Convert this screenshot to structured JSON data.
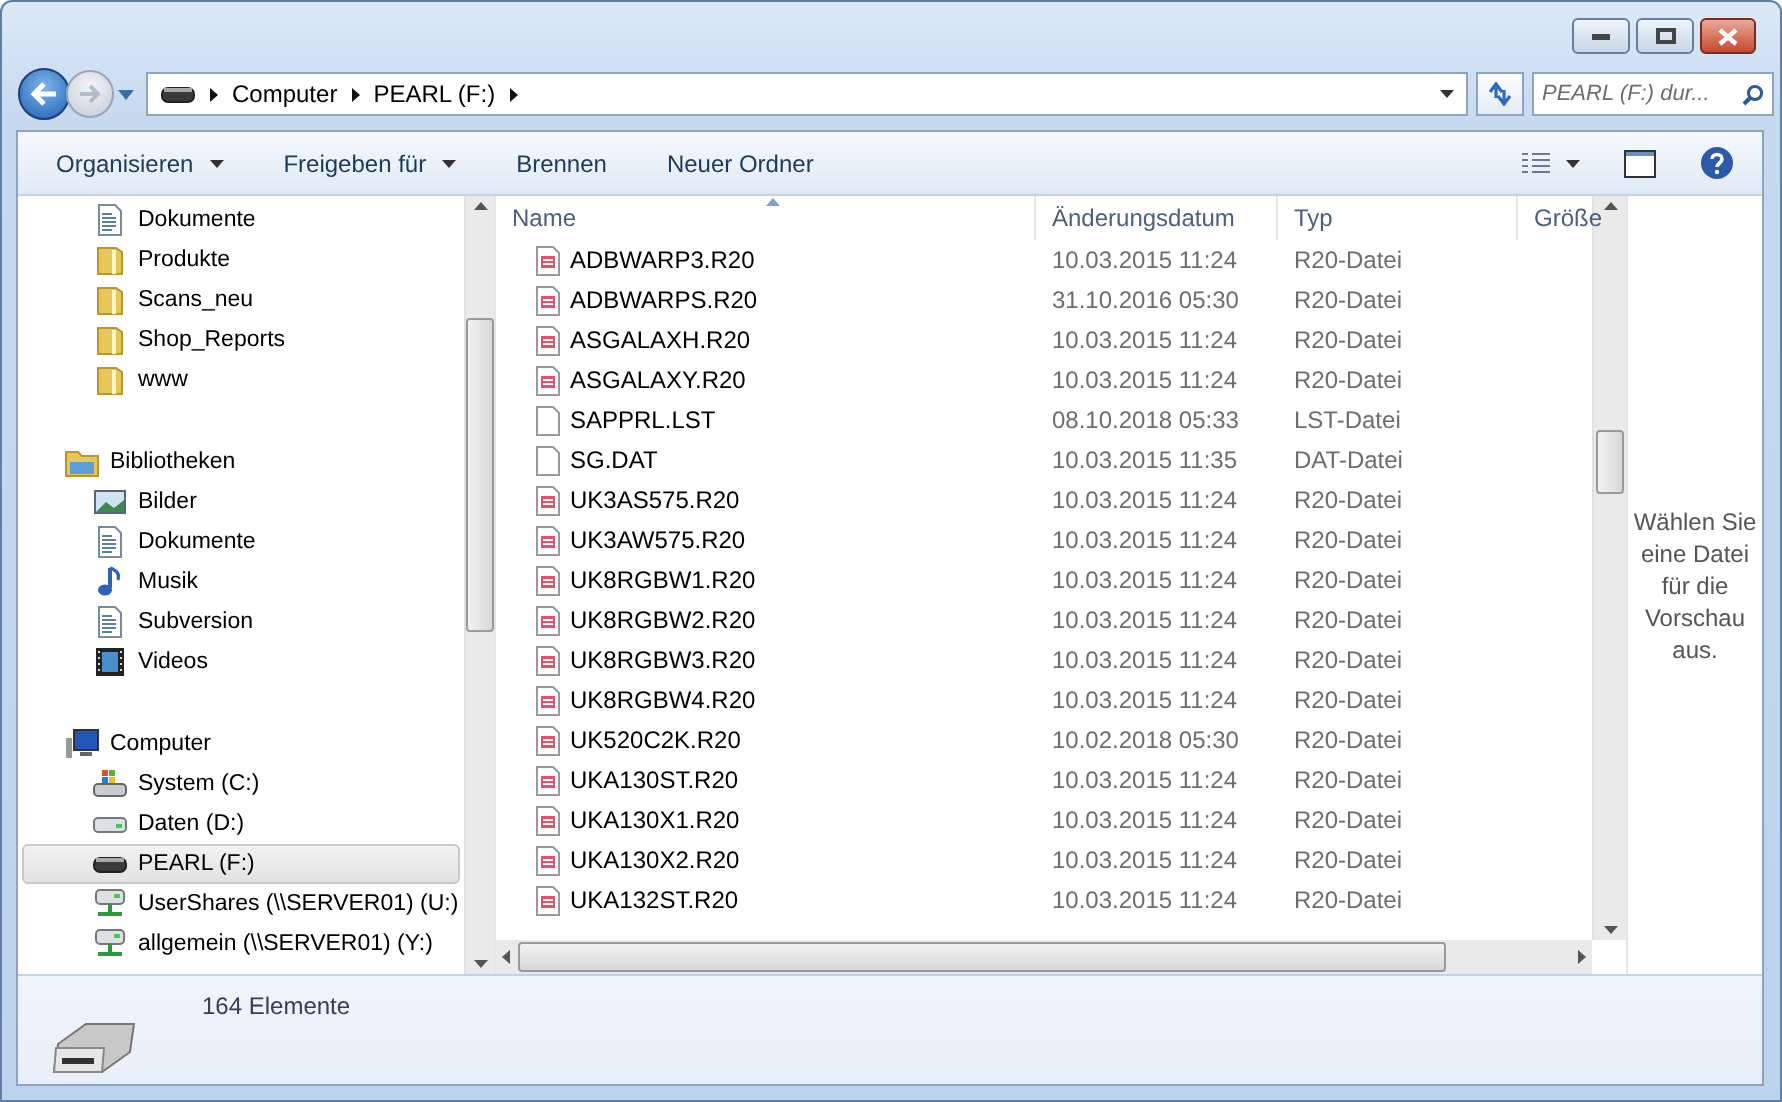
{
  "address_bar": {
    "breadcrumbs": [
      "Computer",
      "PEARL (F:)"
    ]
  },
  "search": {
    "placeholder": "PEARL (F:) dur..."
  },
  "toolbar": {
    "buttons": [
      {
        "label": "Organisieren",
        "dropdown": true
      },
      {
        "label": "Freigeben für",
        "dropdown": true
      },
      {
        "label": "Brennen",
        "dropdown": false
      },
      {
        "label": "Neuer Ordner",
        "dropdown": false
      }
    ]
  },
  "sidebar": {
    "groups": [
      {
        "items": [
          {
            "label": "Dokumente",
            "kind": "document",
            "selected": false
          },
          {
            "label": "Produkte",
            "kind": "folder",
            "selected": false
          },
          {
            "label": "Scans_neu",
            "kind": "folder",
            "selected": false
          },
          {
            "label": "Shop_Reports",
            "kind": "folder",
            "selected": false
          },
          {
            "label": "www",
            "kind": "folder",
            "selected": false
          }
        ]
      },
      {
        "label": "Bibliotheken",
        "kind": "libraries",
        "selected": false,
        "items": [
          {
            "label": "Bilder",
            "kind": "pictures",
            "selected": false
          },
          {
            "label": "Dokumente",
            "kind": "document",
            "selected": false
          },
          {
            "label": "Musik",
            "kind": "music",
            "selected": false
          },
          {
            "label": "Subversion",
            "kind": "document",
            "selected": false
          },
          {
            "label": "Videos",
            "kind": "video",
            "selected": false
          }
        ]
      },
      {
        "label": "Computer",
        "kind": "computer",
        "selected": false,
        "items": [
          {
            "label": "System (C:)",
            "kind": "system-drive",
            "selected": false
          },
          {
            "label": "Daten (D:)",
            "kind": "drive",
            "selected": false
          },
          {
            "label": "PEARL (F:)",
            "kind": "removable",
            "selected": true
          },
          {
            "label": "UserShares (\\\\SERVER01) (U:)",
            "kind": "network",
            "selected": false
          },
          {
            "label": "allgemein (\\\\SERVER01) (Y:)",
            "kind": "network",
            "selected": false
          }
        ]
      }
    ]
  },
  "file_list": {
    "columns": [
      {
        "label": "Name",
        "sorted": true
      },
      {
        "label": "Änderungsdatum",
        "sorted": false
      },
      {
        "label": "Typ",
        "sorted": false
      },
      {
        "label": "Größe",
        "sorted": false
      }
    ],
    "rows": [
      {
        "name": "ADBWARP3.R20",
        "modified": "10.03.2015 11:24",
        "type": "R20-Datei",
        "kind": "r20"
      },
      {
        "name": "ADBWARPS.R20",
        "modified": "31.10.2016 05:30",
        "type": "R20-Datei",
        "kind": "r20"
      },
      {
        "name": "ASGALAXH.R20",
        "modified": "10.03.2015 11:24",
        "type": "R20-Datei",
        "kind": "r20"
      },
      {
        "name": "ASGALAXY.R20",
        "modified": "10.03.2015 11:24",
        "type": "R20-Datei",
        "kind": "r20"
      },
      {
        "name": "SAPPRL.LST",
        "modified": "08.10.2018 05:33",
        "type": "LST-Datei",
        "kind": "plain"
      },
      {
        "name": "SG.DAT",
        "modified": "10.03.2015 11:35",
        "type": "DAT-Datei",
        "kind": "plain"
      },
      {
        "name": "UK3AS575.R20",
        "modified": "10.03.2015 11:24",
        "type": "R20-Datei",
        "kind": "r20"
      },
      {
        "name": "UK3AW575.R20",
        "modified": "10.03.2015 11:24",
        "type": "R20-Datei",
        "kind": "r20"
      },
      {
        "name": "UK8RGBW1.R20",
        "modified": "10.03.2015 11:24",
        "type": "R20-Datei",
        "kind": "r20"
      },
      {
        "name": "UK8RGBW2.R20",
        "modified": "10.03.2015 11:24",
        "type": "R20-Datei",
        "kind": "r20"
      },
      {
        "name": "UK8RGBW3.R20",
        "modified": "10.03.2015 11:24",
        "type": "R20-Datei",
        "kind": "r20"
      },
      {
        "name": "UK8RGBW4.R20",
        "modified": "10.03.2015 11:24",
        "type": "R20-Datei",
        "kind": "r20"
      },
      {
        "name": "UK520C2K.R20",
        "modified": "10.02.2018 05:30",
        "type": "R20-Datei",
        "kind": "r20"
      },
      {
        "name": "UKA130ST.R20",
        "modified": "10.03.2015 11:24",
        "type": "R20-Datei",
        "kind": "r20"
      },
      {
        "name": "UKA130X1.R20",
        "modified": "10.03.2015 11:24",
        "type": "R20-Datei",
        "kind": "r20"
      },
      {
        "name": "UKA130X2.R20",
        "modified": "10.03.2015 11:24",
        "type": "R20-Datei",
        "kind": "r20"
      },
      {
        "name": "UKA132ST.R20",
        "modified": "10.03.2015 11:24",
        "type": "R20-Datei",
        "kind": "r20"
      }
    ]
  },
  "preview_pane": {
    "message": "Wählen Sie eine Datei für die Vorschau aus."
  },
  "details_pane": {
    "item_count": "164 Elemente"
  }
}
